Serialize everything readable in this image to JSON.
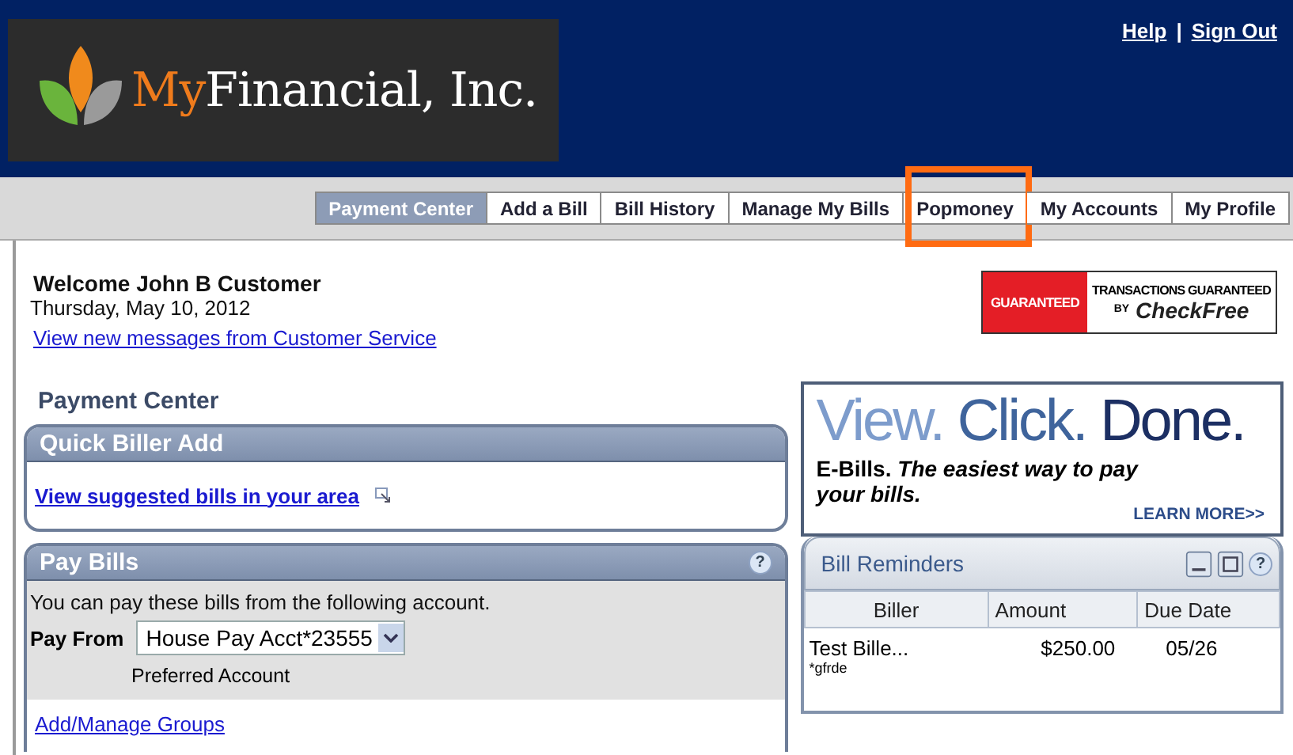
{
  "logo": {
    "prefix": "My",
    "name": "Financial, Inc."
  },
  "top_links": [
    "Help",
    "Sign Out"
  ],
  "top_link_separator": "|",
  "tabs": [
    {
      "label": "Payment Center",
      "selected": true,
      "highlighted": false
    },
    {
      "label": "Add a Bill",
      "selected": false,
      "highlighted": false
    },
    {
      "label": "Bill History",
      "selected": false,
      "highlighted": false
    },
    {
      "label": "Manage My Bills",
      "selected": false,
      "highlighted": false
    },
    {
      "label": "Popmoney",
      "selected": false,
      "highlighted": true
    },
    {
      "label": "My Accounts",
      "selected": false,
      "highlighted": false
    },
    {
      "label": "My Profile",
      "selected": false,
      "highlighted": false
    }
  ],
  "welcome": {
    "greeting": "Welcome John B Customer",
    "date": "Thursday, May 10, 2012",
    "messages_link": "View new messages from Customer Service"
  },
  "guarantee_badge": {
    "stamp": "GUARANTEED",
    "line1": "TRANSACTIONS GUARANTEED",
    "by": "BY",
    "brand": "CheckFree"
  },
  "section_title": "Payment Center",
  "quick_biller": {
    "title": "Quick Biller Add",
    "link": "View suggested bills in your area"
  },
  "pay_bills": {
    "title": "Pay Bills",
    "help": "?",
    "intro": "You can pay these bills from the following account.",
    "pay_from_label": "Pay From",
    "account": "House Pay Acct*23555",
    "account_note": "Preferred Account",
    "groups_link": "Add/Manage Groups"
  },
  "ad": {
    "words": [
      "View.",
      "Click.",
      "Done."
    ],
    "tagline": "E-Bills. *The easiest way to pay your bills.*",
    "learn_more": "LEARN MORE>>"
  },
  "bill_reminders": {
    "title": "Bill Reminders",
    "help": "?",
    "columns": [
      "Biller",
      "Amount",
      "Due Date"
    ],
    "rows": [
      {
        "biller": "Test Bille...",
        "note": "*gfrde",
        "amount": "$250.00",
        "due": "05/26"
      }
    ]
  }
}
